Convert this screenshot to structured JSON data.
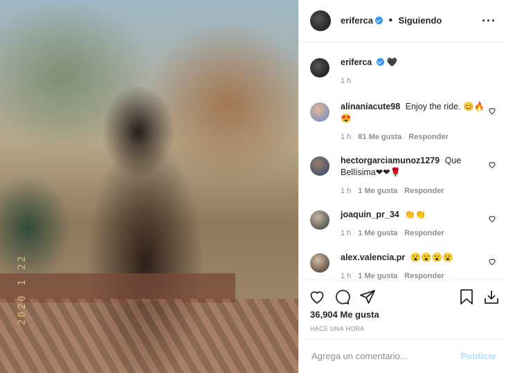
{
  "header": {
    "username": "eriferca",
    "follow_status": "Siguiendo",
    "separator": "•"
  },
  "caption": {
    "username": "eriferca",
    "text": "🖤",
    "time": "1 h"
  },
  "comments": [
    {
      "username": "alinaniacute98",
      "text": "Enjoy the ride. 😊🔥😍",
      "time": "1 h",
      "likes": "81 Me gusta",
      "reply": "Responder"
    },
    {
      "username": "hectorgarciamunoz1279",
      "text": "Que Bellísima❤❤🌹",
      "time": "1 h",
      "likes": "1 Me gusta",
      "reply": "Responder"
    },
    {
      "username": "joaquin_pr_34",
      "text": "👏👏",
      "time": "1 h",
      "likes": "1 Me gusta",
      "reply": "Responder"
    },
    {
      "username": "alex.valencia.pr",
      "text": "😮😮😮😮",
      "time": "1 h",
      "likes": "1 Me gusta",
      "reply": "Responder"
    }
  ],
  "likes_count": "36,904 Me gusta",
  "posted_time": "HACE UNA HORA",
  "add_comment": {
    "placeholder": "Agrega un comentario...",
    "publish_label": "Publicar"
  },
  "photo": {
    "date_stamp": "2020 1 22"
  },
  "colors": {
    "verified": "#3897f0",
    "publish": "#b2dffc",
    "muted": "#8e8e8e"
  }
}
